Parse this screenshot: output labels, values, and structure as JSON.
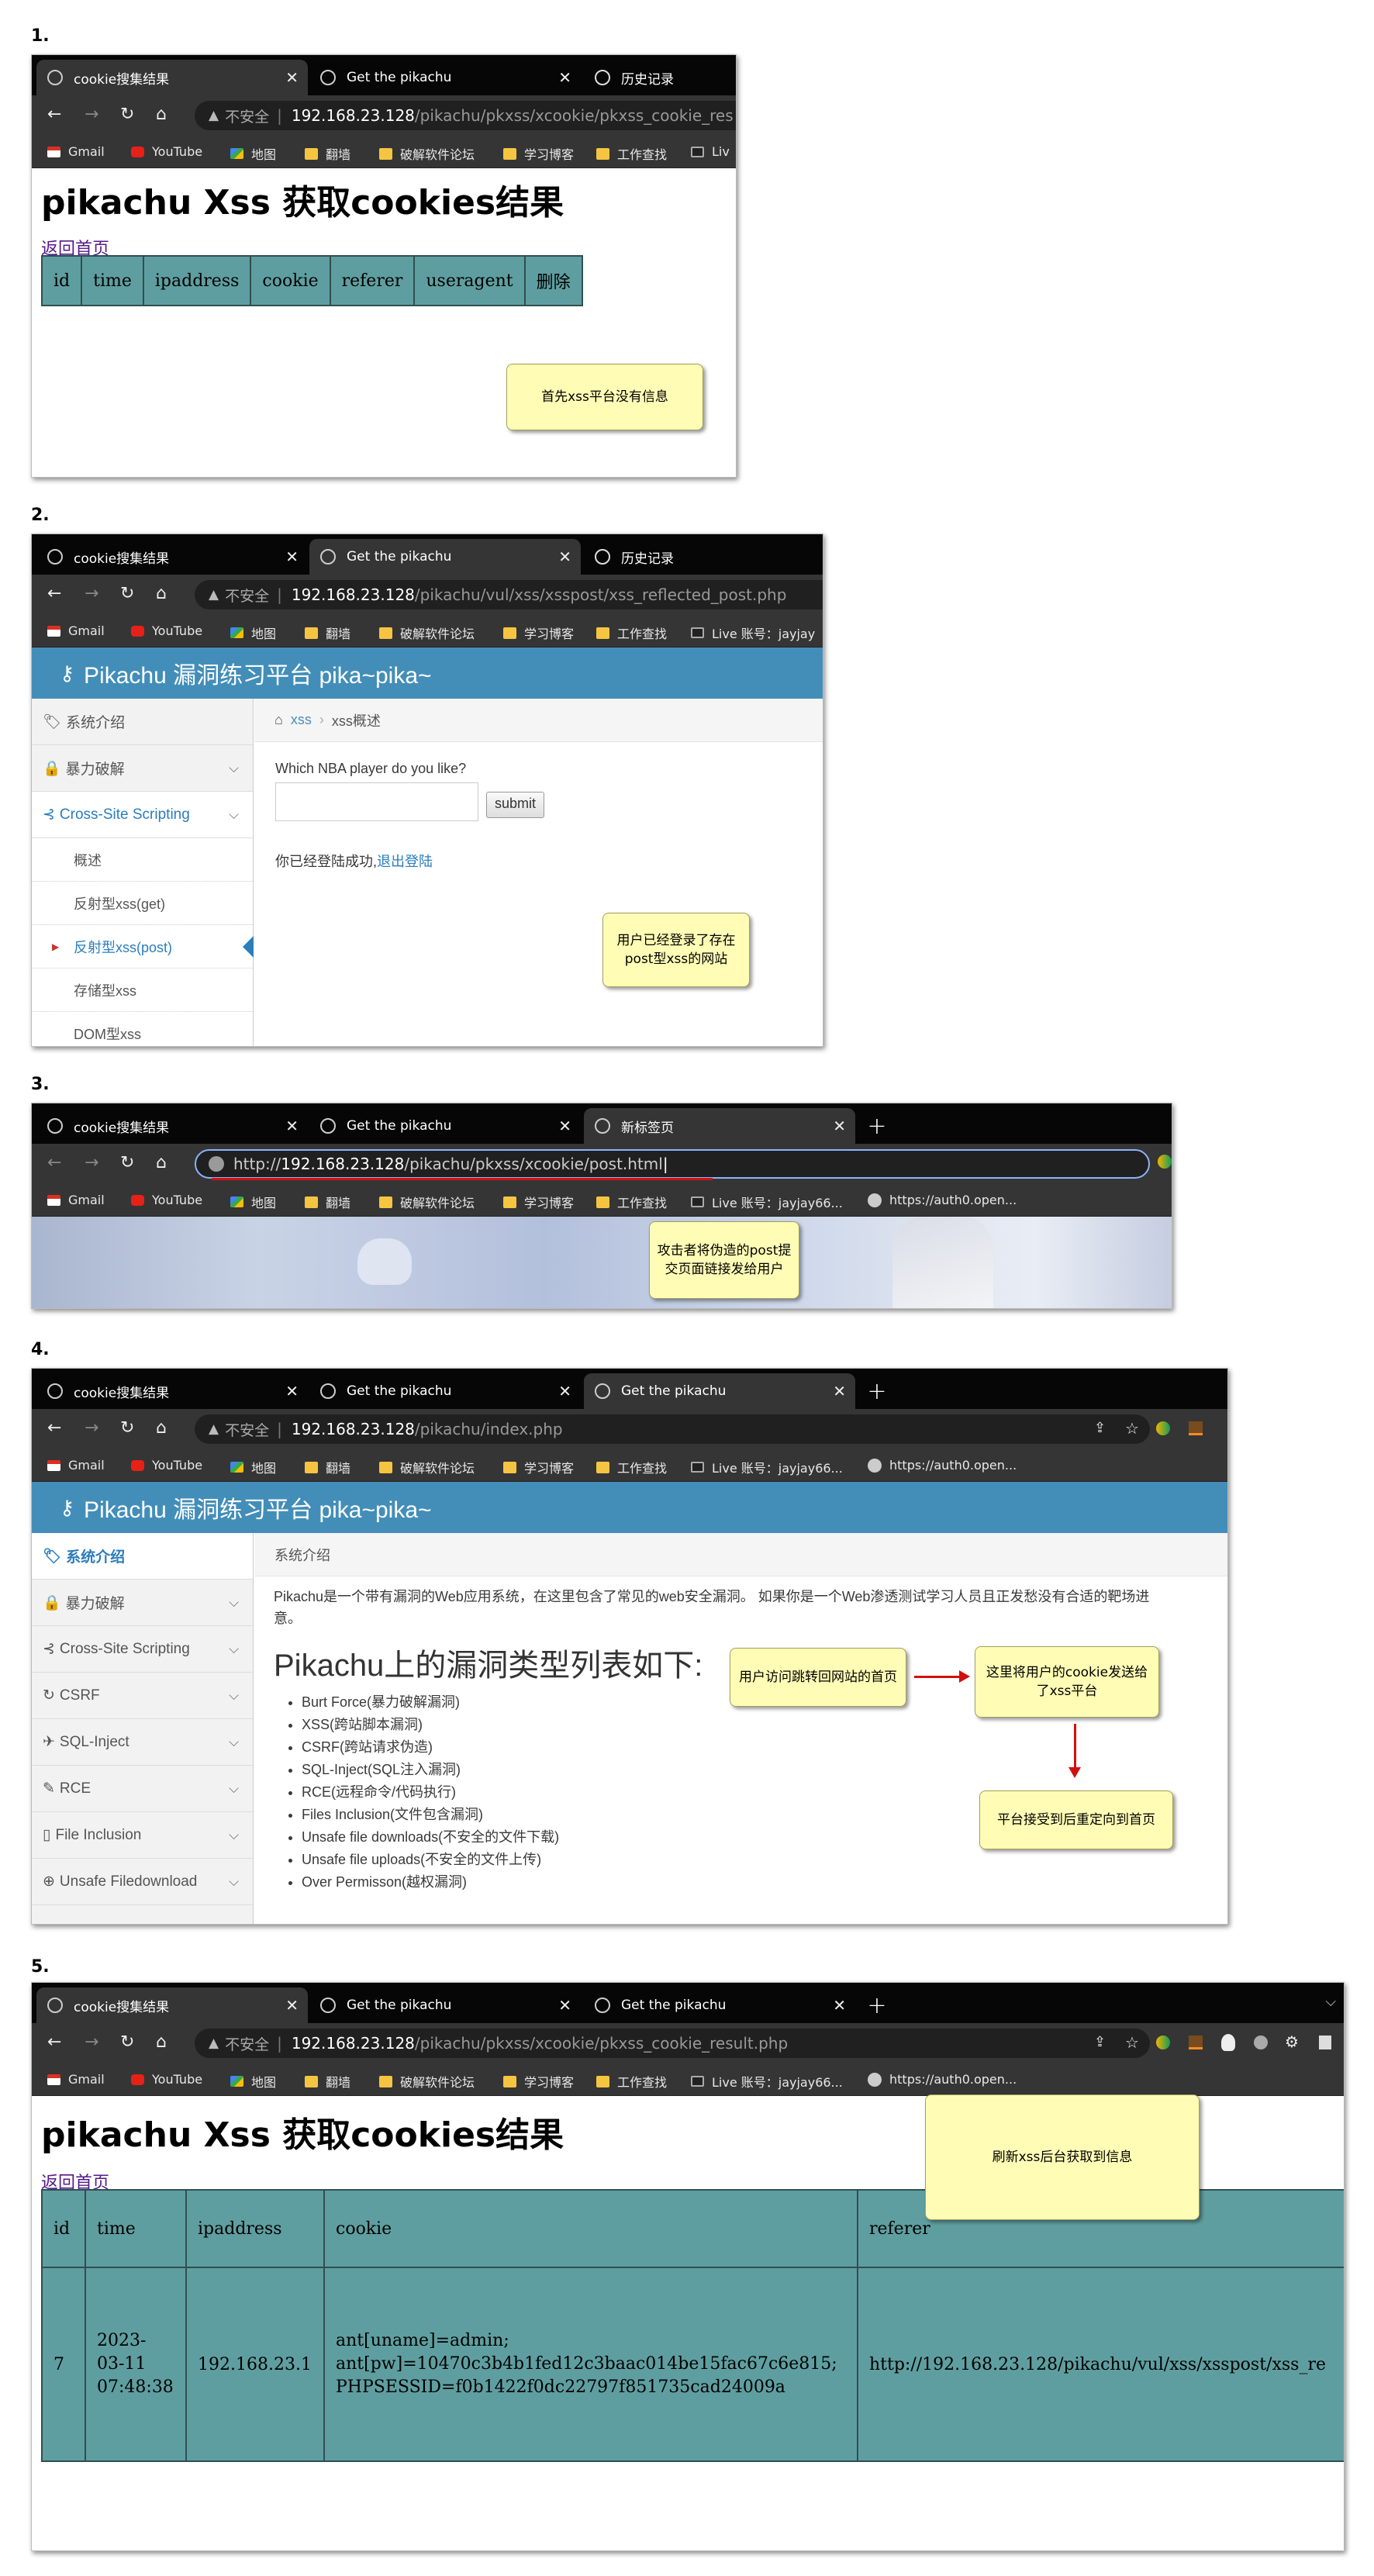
{
  "browser": {
    "insecure_label": "不安全",
    "bookmarks": [
      "Gmail",
      "YouTube",
      "地图",
      "翻墙",
      "破解软件论坛",
      "学习博客",
      "工作查找"
    ],
    "live_full": "Live 账号：jayjay66...",
    "live_cut": "Live 账号：jayjay",
    "live_short": "Liv",
    "auth0": "https://auth0.open...",
    "tab_cookie": "cookie搜集结果",
    "tab_pikachu": "Get the pikachu",
    "tab_history": "历史记录",
    "tab_newtab": "新标签页"
  },
  "step1": {
    "num": "1.",
    "host": "192.168.23.128",
    "path": "/pikachu/pkxss/xcookie/pkxss_cookie_res",
    "title": "pikachu Xss 获取cookies结果",
    "back": "返回首页",
    "columns": [
      "id",
      "time",
      "ipaddress",
      "cookie",
      "referer",
      "useragent",
      "删除"
    ],
    "note": "首先xss平台没有信息"
  },
  "step2": {
    "num": "2.",
    "host": "192.168.23.128",
    "path": "/pikachu/vul/xss/xsspost/xss_reflected_post.php",
    "brand": "Pikachu 漏洞练习平台 pika~pika~",
    "menu": [
      "系统介绍",
      "暴力破解",
      "Cross-Site Scripting"
    ],
    "submenu": [
      "概述",
      "反射型xss(get)",
      "反射型xss(post)",
      "存储型xss",
      "DOM型xss"
    ],
    "crumb_link": "xss",
    "crumb_current": "xss概述",
    "question": "Which NBA player do you like?",
    "submit": "submit",
    "login_msg": "你已经登陆成功,",
    "logout": "退出登陆",
    "note": "用户已经登录了存在post型xss的网站"
  },
  "step3": {
    "num": "3.",
    "url_prefix": "http://",
    "host": "192.168.23.128",
    "path": "/pikachu/pkxss/xcookie/post.html",
    "note": "攻击者将伪造的post提交页面链接发给用户"
  },
  "step4": {
    "num": "4.",
    "host": "192.168.23.128",
    "path": "/pikachu/index.php",
    "brand": "Pikachu 漏洞练习平台 pika~pika~",
    "menu": [
      "系统介绍",
      "暴力破解",
      "Cross-Site Scripting",
      "CSRF",
      "SQL-Inject",
      "RCE",
      "File Inclusion",
      "Unsafe Filedownload"
    ],
    "crumb": "系统介绍",
    "intro": "Pikachu是一个带有漏洞的Web应用系统，在这里包含了常见的web安全漏洞。 如果你是一个Web渗透测试学习人员且正发愁没有合适的靶场进行练习，那么Pikachu可能正合你意。",
    "intro_line1": "Pikachu是一个带有漏洞的Web应用系统，在这里包含了常见的web安全漏洞。 如果你是一个Web渗透测试学习人员且正发愁没有合适的靶场进",
    "intro_line2": "意。",
    "heading": "Pikachu上的漏洞类型列表如下:",
    "vulns": [
      "Burt Force(暴力破解漏洞)",
      "XSS(跨站脚本漏洞)",
      "CSRF(跨站请求伪造)",
      "SQL-Inject(SQL注入漏洞)",
      "RCE(远程命令/代码执行)",
      "Files Inclusion(文件包含漏洞)",
      "Unsafe file downloads(不安全的文件下载)",
      "Unsafe file uploads(不安全的文件上传)",
      "Over Permisson(越权漏洞)"
    ],
    "note_a": "用户访问跳转回网站的首页",
    "note_b": "这里将用户的cookie发送给了xss平台",
    "note_c": "平台接受到后重定向到首页"
  },
  "step5": {
    "num": "5.",
    "host": "192.168.23.128",
    "path": "/pikachu/pkxss/xcookie/pkxss_cookie_result.php",
    "title": "pikachu Xss 获取cookies结果",
    "back": "返回首页",
    "columns": [
      "id",
      "time",
      "ipaddress",
      "cookie",
      "referer"
    ],
    "row": {
      "id": "7",
      "time_l1": "2023-",
      "time_l2": "03-11",
      "time_l3": "07:48:38",
      "ip": "192.168.23.1",
      "cookie_l1": "ant[uname]=admin;",
      "cookie_l2": "ant[pw]=10470c3b4b1fed12c3baac014be15fac67c6e815;",
      "cookie_l3": "PHPSESSID=f0b1422f0dc22797f851735cad24009a",
      "referer": "http://192.168.23.128/pikachu/vul/xss/xsspost/xss_re"
    },
    "note": "刷新xss后台获取到信息"
  },
  "colors": {
    "table_bg": "#5f9ea0",
    "pk_header": "#438eb9",
    "note_bg": "#fffdb5",
    "arrow": "#d01010"
  }
}
